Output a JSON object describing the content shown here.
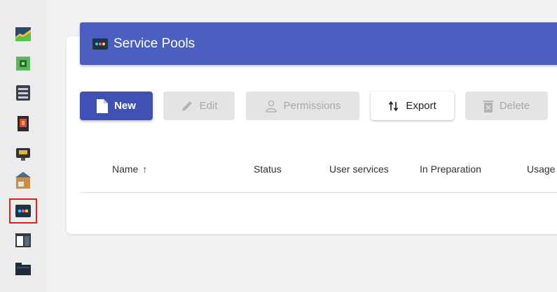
{
  "sidebar": {
    "items": [
      {
        "icon": "dashboard-icon",
        "selected": false
      },
      {
        "icon": "chip-icon",
        "selected": false
      },
      {
        "icon": "server-icon",
        "selected": false
      },
      {
        "icon": "authenticator-icon",
        "selected": false
      },
      {
        "icon": "network-icon",
        "selected": false
      },
      {
        "icon": "transport-icon",
        "selected": false
      },
      {
        "icon": "service-pools-icon",
        "selected": true
      },
      {
        "icon": "window-icon",
        "selected": false
      },
      {
        "icon": "folder-icon",
        "selected": false
      }
    ]
  },
  "header": {
    "title": "Service Pools",
    "icon": "service-pools-icon"
  },
  "toolbar": {
    "new_label": "New",
    "edit_label": "Edit",
    "permissions_label": "Permissions",
    "export_label": "Export",
    "delete_label": "Delete"
  },
  "table": {
    "columns": [
      {
        "label": "Name",
        "sort": "ascending"
      },
      {
        "label": "Status"
      },
      {
        "label": "User services"
      },
      {
        "label": "In Preparation"
      },
      {
        "label": "Usage"
      }
    ],
    "rows": []
  },
  "colors": {
    "accent": "#3f51b5",
    "header": "#4a5fbf",
    "selection_outline": "#e02020"
  }
}
